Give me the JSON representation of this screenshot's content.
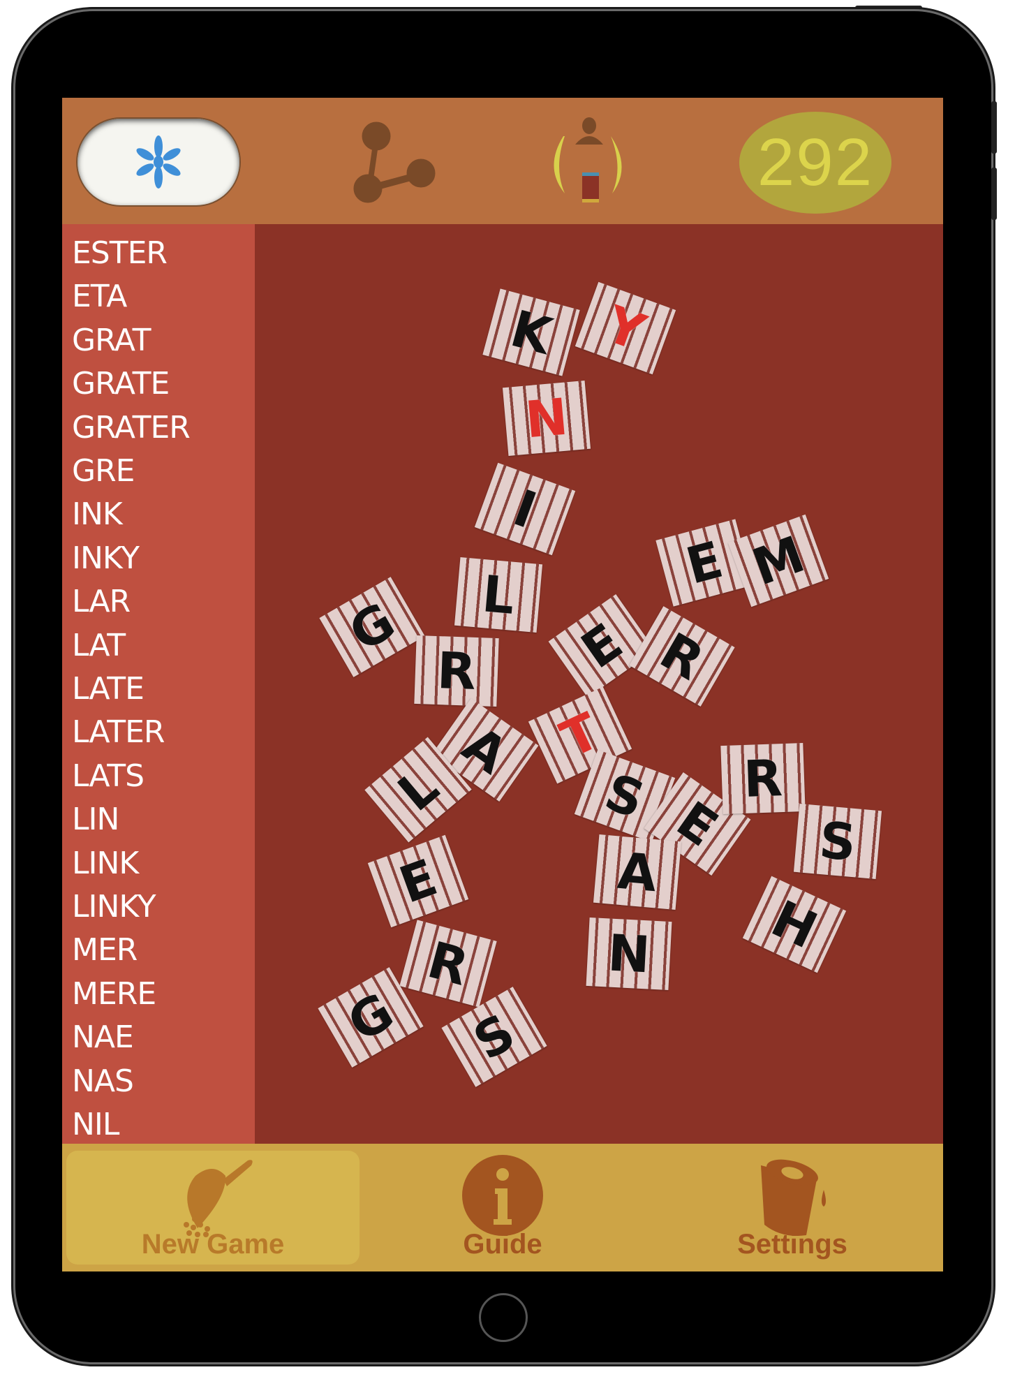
{
  "header": {
    "menu_icon": "asterisk-icon",
    "share_icon": "share-nodes-icon",
    "player_icon": "player-timer-icon",
    "score": "292"
  },
  "word_list": [
    "ESTER",
    "ETA",
    "GRAT",
    "GRATE",
    "GRATER",
    "GRE",
    "INK",
    "INKY",
    "LAR",
    "LAT",
    "LATE",
    "LATER",
    "LATS",
    "LIN",
    "LINK",
    "LINKY",
    "MER",
    "MERE",
    "NAE",
    "NAS",
    "NIL"
  ],
  "tiles": [
    {
      "letter": "K",
      "color": "black"
    },
    {
      "letter": "Y",
      "color": "red"
    },
    {
      "letter": "N",
      "color": "red"
    },
    {
      "letter": "I",
      "color": "black"
    },
    {
      "letter": "L",
      "color": "black"
    },
    {
      "letter": "G",
      "color": "black"
    },
    {
      "letter": "R",
      "color": "black"
    },
    {
      "letter": "E",
      "color": "black"
    },
    {
      "letter": "R",
      "color": "black"
    },
    {
      "letter": "E",
      "color": "black"
    },
    {
      "letter": "M",
      "color": "black"
    },
    {
      "letter": "A",
      "color": "black"
    },
    {
      "letter": "T",
      "color": "red"
    },
    {
      "letter": "L",
      "color": "black"
    },
    {
      "letter": "S",
      "color": "black"
    },
    {
      "letter": "E",
      "color": "black"
    },
    {
      "letter": "R",
      "color": "black"
    },
    {
      "letter": "S",
      "color": "black"
    },
    {
      "letter": "A",
      "color": "black"
    },
    {
      "letter": "N",
      "color": "black"
    },
    {
      "letter": "H",
      "color": "black"
    },
    {
      "letter": "E",
      "color": "black"
    },
    {
      "letter": "R",
      "color": "black"
    },
    {
      "letter": "G",
      "color": "black"
    },
    {
      "letter": "S",
      "color": "black"
    }
  ],
  "colors": {
    "red": "#e0302a",
    "black": "#111111",
    "topbar": "#b86f3f",
    "sidebar": "#bf5040",
    "board": "#8b3226",
    "bottombar": "#cda446"
  },
  "bottom_tabs": [
    {
      "label": "New Game",
      "icon": "scoop-icon",
      "active": true
    },
    {
      "label": "Guide",
      "icon": "info-icon",
      "active": false
    },
    {
      "label": "Settings",
      "icon": "paint-bucket-icon",
      "active": false
    }
  ]
}
